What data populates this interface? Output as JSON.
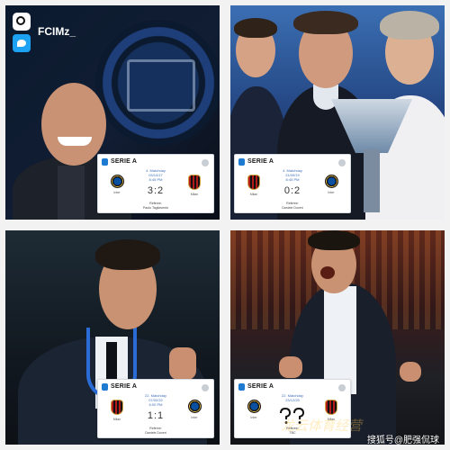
{
  "header": {
    "handle": "FCIMz_",
    "instagram_icon": "instagram-icon",
    "twitter_icon": "twitter-icon"
  },
  "cards": [
    {
      "competition": "SERIE A",
      "matchday": "4. Matchday",
      "date": "03/10/17",
      "time": "8:45 PM",
      "home": "Inter",
      "away": "Milan",
      "score": "3:2",
      "referee_label": "Referee:",
      "referee": "Paolo Tagliavento"
    },
    {
      "competition": "SERIE A",
      "matchday": "4. Matchday",
      "date": "21/09/19",
      "time": "8:45 PM",
      "home": "Milan",
      "away": "Inter",
      "score": "0:2",
      "referee_label": "Referee:",
      "referee": "Daniele Doveri"
    },
    {
      "competition": "SERIE A",
      "matchday": "22. Matchday",
      "date": "07/02/22",
      "time": "6:00 PM",
      "home": "Milan",
      "away": "Inter",
      "score": "1:1",
      "referee_label": "Referee:",
      "referee": "Daniele Doveri"
    },
    {
      "competition": "SERIE A",
      "matchday": "22. Matchday",
      "date": "23/12/25",
      "time": "",
      "home": "Inter",
      "away": "Milan",
      "score": "",
      "referee_label": "Referee:",
      "referee": "TBC"
    }
  ],
  "footer": {
    "watermark": "搜狐号@肥强侃球",
    "faint_text": "龙云体育经营"
  },
  "colors": {
    "inter_blue": "#0a4fa0",
    "milan_red": "#b31b1b",
    "card_bg": "#ffffff"
  }
}
